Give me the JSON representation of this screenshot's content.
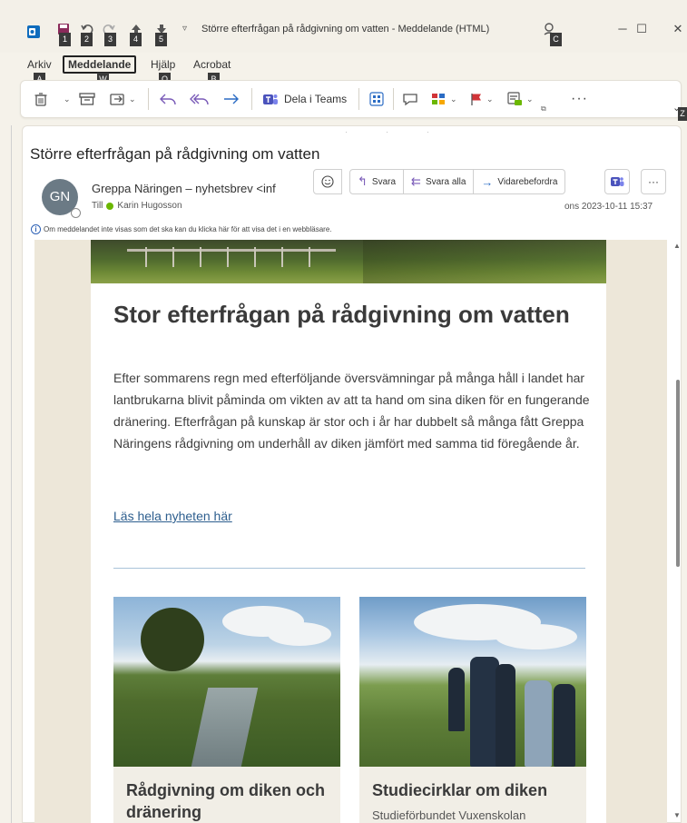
{
  "window": {
    "title": "Större efterfrågan på rådgivning om vatten - Meddelande (HTML)",
    "controls": {
      "minimize": "─",
      "maximize": "☐",
      "close": "✕"
    },
    "keytips": {
      "qat1": "1",
      "qat2": "2",
      "qat3": "3",
      "qat4": "4",
      "qat5": "5",
      "search": "C",
      "tab_file": "A",
      "tab_message": "W",
      "tab_help": "Q",
      "tab_acrobat": "B",
      "ribbon_end": "Z"
    }
  },
  "tabs": [
    {
      "label": "Arkiv"
    },
    {
      "label": "Meddelande"
    },
    {
      "label": "Hjälp"
    },
    {
      "label": "Acrobat"
    }
  ],
  "ribbon": {
    "share_teams_label": "Dela i Teams",
    "more_label": "···"
  },
  "message": {
    "subject": "Större efterfrågan på rådgivning om vatten",
    "avatar_initials": "GN",
    "sender": "Greppa Näringen – nyhetsbrev <inf",
    "to_label": "Till",
    "recipient": "Karin Hugosson",
    "date": "ons 2023-10-11 15:37",
    "info_text": "Om meddelandet inte visas som det ska kan du klicka här för att visa det i en webbläsare.",
    "actions": {
      "reply": "Svara",
      "reply_all": "Svara alla",
      "forward": "Vidarebefordra",
      "more": "···"
    }
  },
  "newsletter": {
    "headline": "Stor efterfrågan på rådgivning om vatten",
    "lead": "Efter sommarens regn med efterföljande översvämningar på många håll i landet har lantbrukarna blivit påminda om vikten av att ta hand om sina diken för en fungerande dränering. Efterfrågan på kunskap är stor och i år har dubbelt så många fått Greppa Näringens rådgivning om underhåll av diken jämfört med samma tid föregående år.",
    "read_more": "Läs hela nyheten här",
    "cards": [
      {
        "title": "Rådgivning om diken och dränering",
        "subtitle": ""
      },
      {
        "title": "Studiecirklar om diken",
        "subtitle": "Studieförbundet Vuxenskolan"
      }
    ]
  },
  "colors": {
    "accent": "#2b6cc4",
    "teams": "#4b53bc",
    "flag": "#d13438",
    "presence": "#6bb700",
    "link": "#2d5e8e",
    "body_bg": "#ede7d9"
  }
}
